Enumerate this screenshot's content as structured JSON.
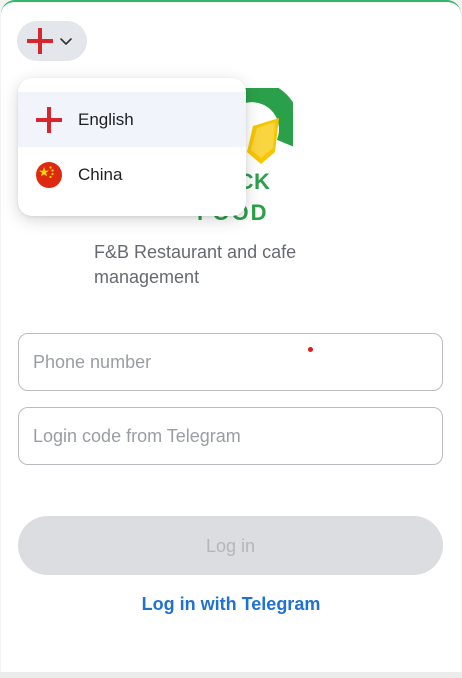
{
  "language_toggle": {
    "current_flag": "england-flag-icon",
    "chevron": "chevron-down-icon"
  },
  "brand": {
    "name_line1": "QUICK",
    "name_line2": "FOOD",
    "tagline": "F&B Restaurant and cafe management",
    "colors": {
      "green": "#2aa04a",
      "yellow": "#f7c600"
    }
  },
  "language_menu": {
    "items": [
      {
        "label": "English",
        "icon": "england-flag-icon",
        "selected": true
      },
      {
        "label": "China",
        "icon": "china-flag-icon",
        "selected": false
      }
    ]
  },
  "form": {
    "phone_placeholder": "Phone number",
    "code_placeholder": "Login code from Telegram",
    "login_label": "Log in",
    "telegram_link": "Log in with Telegram"
  },
  "colors": {
    "accent_top": "#33b56a",
    "link_blue": "#1f72d0",
    "disabled_bg": "#dbdde1"
  }
}
